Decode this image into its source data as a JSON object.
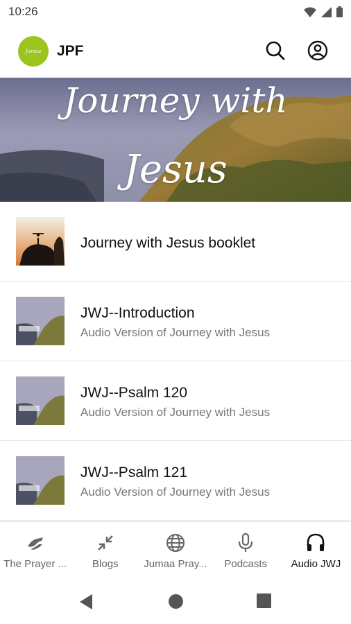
{
  "status_bar": {
    "time": "10:26",
    "icons": [
      "wifi-icon",
      "signal-icon",
      "battery-icon"
    ]
  },
  "app_bar": {
    "logo_text": "Jumaa",
    "title": "JPF",
    "actions": [
      "search-icon",
      "account-icon"
    ],
    "logo_color": "#9bc41e"
  },
  "banner": {
    "line1": "Journey with",
    "line2": "Jesus"
  },
  "list": [
    {
      "title": "Journey with Jesus booklet",
      "subtitle": ""
    },
    {
      "title": "JWJ--Introduction",
      "subtitle": "Audio Version of Journey with Jesus"
    },
    {
      "title": "JWJ--Psalm 120",
      "subtitle": "Audio Version of Journey with Jesus"
    },
    {
      "title": "JWJ--Psalm 121",
      "subtitle": "Audio Version of Journey with Jesus"
    }
  ],
  "bottom_nav": [
    {
      "label": "The Prayer ...",
      "icon": "praying-hands-icon",
      "active": false
    },
    {
      "label": "Blogs",
      "icon": "collapse-arrows-icon",
      "active": false
    },
    {
      "label": "Jumaa Pray...",
      "icon": "globe-icon",
      "active": false
    },
    {
      "label": "Podcasts",
      "icon": "microphone-icon",
      "active": false
    },
    {
      "label": "Audio JWJ",
      "icon": "headphones-icon",
      "active": true
    }
  ],
  "system_nav": [
    "back-icon",
    "home-icon",
    "recents-icon"
  ]
}
